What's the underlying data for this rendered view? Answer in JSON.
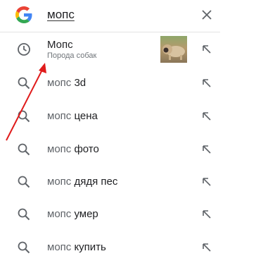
{
  "search": {
    "query": "мопс"
  },
  "entity_suggestion": {
    "title": "Мопс",
    "subtitle": "Порода собак",
    "image": "pug-dog-photo"
  },
  "suggestions": [
    {
      "prefix": "мопс",
      "suffix": " 3d"
    },
    {
      "prefix": "мопс",
      "suffix": " цена"
    },
    {
      "prefix": "мопс",
      "suffix": " фото"
    },
    {
      "prefix": "мопс",
      "suffix": " дядя пес"
    },
    {
      "prefix": "мопс",
      "suffix": " умер"
    },
    {
      "prefix": "мопс",
      "suffix": " купить"
    }
  ],
  "icons": {
    "logo": "google-g-logo",
    "clear": "close-icon",
    "history": "clock-icon",
    "search": "search-icon",
    "fill": "arrow-up-left-icon"
  },
  "colors": {
    "annotation_arrow": "#e01b1b",
    "google_blue": "#4285F4",
    "google_red": "#EA4335",
    "google_yellow": "#FBBC05",
    "google_green": "#34A853"
  }
}
